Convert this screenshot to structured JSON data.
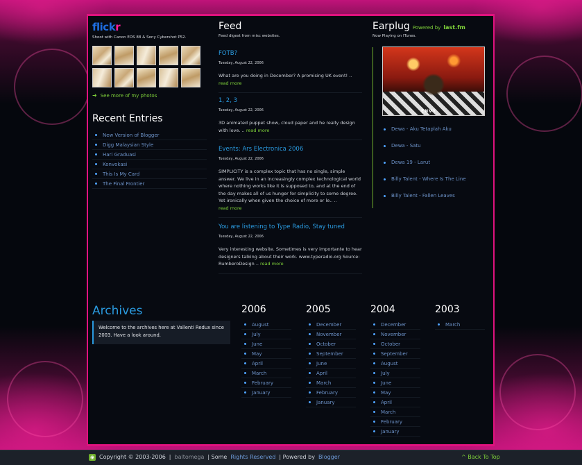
{
  "flickr": {
    "logo_part1": "flick",
    "logo_part2": "r",
    "subtitle": "Shoot with Canon EOS 88 & Sony Cybershot P52.",
    "more_photos": "See more of my photos"
  },
  "recent": {
    "title": "Recent Entries",
    "items": [
      "New Version of Blogger",
      "Digg Malaysian Style",
      "Hari Graduasi",
      "Konvokasi",
      "This Is My Card",
      "The Final Frontier"
    ]
  },
  "feed": {
    "title": "Feed",
    "subtitle": "Feed digest from misc websites.",
    "read_more": "read more",
    "posts": [
      {
        "title": "FOTB?",
        "date": "Tuesday, August 22, 2006",
        "body": "What are you doing in December? A promising UK event! .."
      },
      {
        "title": "1, 2, 3",
        "date": "Tuesday, August 22, 2006",
        "body": "3D animated puppet show, cloud paper and he really design with love. .."
      },
      {
        "title": "Events: Ars Electronica 2006",
        "date": "Tuesday, August 22, 2006",
        "body": "SIMPLICITY is a complex topic that has no single, simple answer. We live in an increasingly complex technological world where nothing works like it is supposed to, and at the end of the day makes all of us hunger for simplicity to some degree. Yet ironically when given the choice of more or le.. .."
      },
      {
        "title": "You are listening to Type Radio, Stay tuned",
        "date": "Tuesday, August 22, 2006",
        "body": "Very interesting website. Sometimes is very importante to hear designers talking about their work. www.typeradio.org Source: RumberoDesign .."
      }
    ]
  },
  "earplug": {
    "title": "Earplug",
    "powered": "Powered by",
    "lastfm": "last.fm",
    "subtitle": "Now Playing on ITunes.",
    "album_label": "ENVY",
    "tracks": [
      "Dewa - Aku Tetaplah Aku",
      "Dewa - Satu",
      "Dewa 19 - Larut",
      "Billy Talent - Where Is The Line",
      "Billy Talent - Fallen Leaves"
    ]
  },
  "archives": {
    "title": "Archives",
    "welcome": "Welcome to the archives here at Vallenti Redux since 2003. Have a look around.",
    "years": [
      {
        "year": "2006",
        "months": [
          "August",
          "July",
          "June",
          "May",
          "April",
          "March",
          "February",
          "January"
        ]
      },
      {
        "year": "2005",
        "months": [
          "December",
          "November",
          "October",
          "September",
          "June",
          "April",
          "March",
          "February",
          "January"
        ]
      },
      {
        "year": "2004",
        "months": [
          "December",
          "November",
          "October",
          "September",
          "August",
          "July",
          "June",
          "May",
          "April",
          "March",
          "February",
          "January"
        ]
      },
      {
        "year": "2003",
        "months": [
          "March"
        ]
      }
    ]
  },
  "footer": {
    "copyright": "Copyright © 2003-2006",
    "sep1": "|",
    "author": "baltomega",
    "sep2": "| Some",
    "rights": "Rights Reserved",
    "sep3": "| Powered by",
    "blogger": "Blogger",
    "back_to_top": "^ Back To Top"
  },
  "colors": {
    "accent_pink": "#e0127f",
    "link_blue": "#2a9adf",
    "link_green": "#7fd13a"
  }
}
